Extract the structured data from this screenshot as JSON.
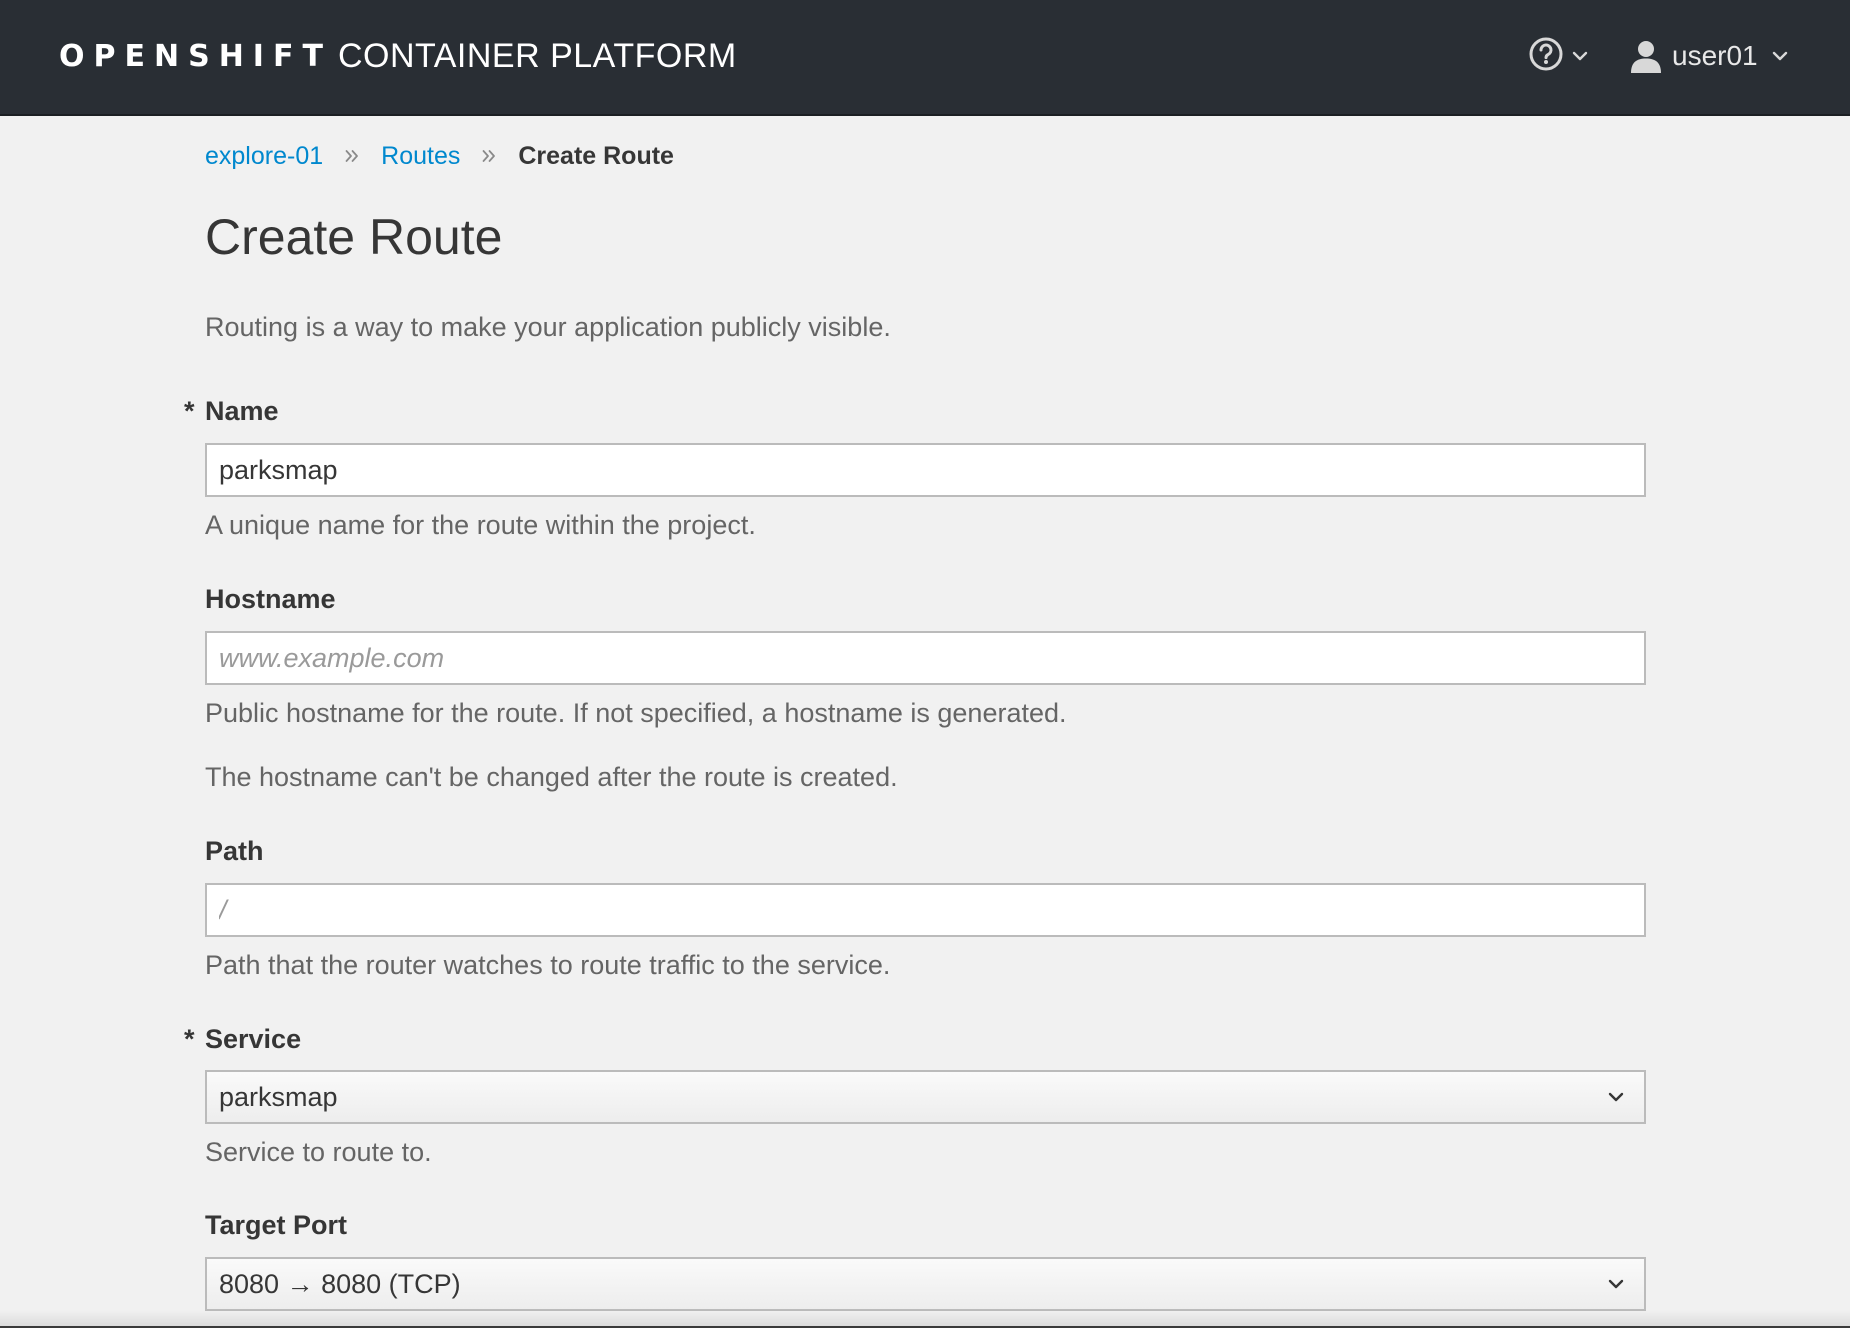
{
  "navbar": {
    "brand_bold": "OPENSHIFT",
    "brand_light": "CONTAINER PLATFORM",
    "help_icon": "question-circle-icon",
    "user_icon": "user-icon",
    "username": "user01"
  },
  "breadcrumb": {
    "project": "explore-01",
    "section": "Routes",
    "current": "Create Route"
  },
  "page": {
    "title": "Create Route",
    "intro": "Routing is a way to make your application publicly visible."
  },
  "form": {
    "name": {
      "label": "Name",
      "required_mark": "*",
      "value": "parksmap",
      "help": "A unique name for the route within the project."
    },
    "hostname": {
      "label": "Hostname",
      "placeholder": "www.example.com",
      "value": "",
      "help": "Public hostname for the route. If not specified, a hostname is generated.",
      "help2": "The hostname can't be changed after the route is created."
    },
    "path": {
      "label": "Path",
      "placeholder": "/",
      "value": "",
      "help": "Path that the router watches to route traffic to the service."
    },
    "service": {
      "label": "Service",
      "required_mark": "*",
      "selected": "parksmap",
      "help": "Service to route to."
    },
    "target_port": {
      "label": "Target Port",
      "selected": "8080 → 8080 (TCP)"
    }
  },
  "colors": {
    "navbar_bg": "#292e34",
    "page_bg": "#f1f1f1",
    "link": "#0088ce",
    "text": "#363636",
    "muted": "#656565"
  }
}
